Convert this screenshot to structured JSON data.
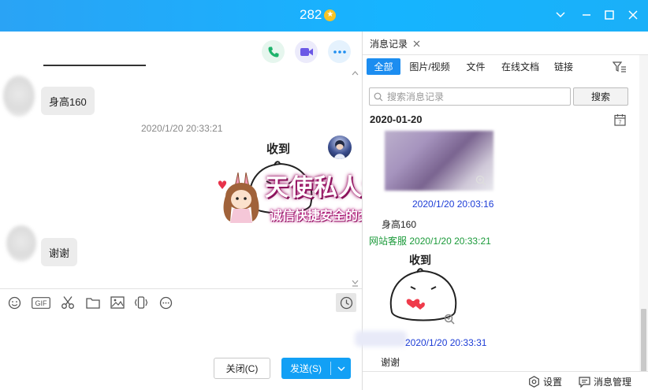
{
  "window": {
    "title": "282",
    "title_badge_icon": "star-badge-icon",
    "controls": [
      "chevron-down-icon",
      "minimize-icon",
      "maximize-icon",
      "close-icon"
    ]
  },
  "chat": {
    "call_buttons": [
      {
        "icon": "phone-icon",
        "color": "#1db36b"
      },
      {
        "icon": "video-call-icon",
        "color": "#6b58e6"
      },
      {
        "icon": "more-icon",
        "color": "#1c8df0"
      }
    ],
    "messages": [
      {
        "side": "left",
        "text": "身高160"
      },
      {
        "side": "right",
        "sticker_caption": "收到"
      },
      {
        "side": "left",
        "text": "谢谢"
      }
    ],
    "timestamp": "2020/1/20 20:33:21",
    "banner": {
      "line1": "天使私人订制",
      "line2": "诚信快捷安全的交友平台"
    },
    "toolbar_icons": [
      "emoji-icon",
      "gif-icon",
      "scissors-icon",
      "folder-icon",
      "image-icon",
      "shake-icon",
      "more-options-icon"
    ],
    "history_icon": "clock-icon",
    "close_button": "关闭(C)",
    "send_button": "发送(S)"
  },
  "history": {
    "tab_label": "消息记录",
    "filters": [
      "全部",
      "图片/视频",
      "文件",
      "在线文档",
      "链接"
    ],
    "active_filter": "全部",
    "search_placeholder": "搜索消息记录",
    "search_button": "搜索",
    "date": "2020-01-20",
    "entries": [
      {
        "time": "2020/1/20 20:03:16",
        "text": "身高160"
      },
      {
        "sender": "网站客服",
        "time": "2020/1/20 20:33:21",
        "sticker_caption": "收到"
      },
      {
        "time": "2020/1/20 20:33:31",
        "text": "谢谢"
      }
    ],
    "settings_label": "设置",
    "manage_label": "消息管理"
  },
  "colors": {
    "titlebar": "#1ab0f8",
    "accent": "#1c8df0",
    "send": "#12a0f5",
    "timestamp_blue": "#1c3cd6",
    "sender_green": "#1b9a3a"
  }
}
